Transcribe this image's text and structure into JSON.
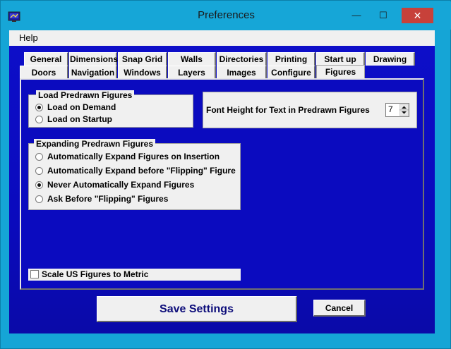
{
  "window": {
    "title": "Preferences",
    "minimize_glyph": "—",
    "maximize_glyph": "☐",
    "close_glyph": "✕"
  },
  "menu": {
    "help": "Help"
  },
  "tabs": {
    "row1": [
      "General",
      "Dimensions",
      "Snap Grid",
      "Walls",
      "Directories",
      "Printing",
      "Start up",
      "Drawing"
    ],
    "row2": [
      "Doors",
      "Navigation",
      "Windows",
      "Layers",
      "Images",
      "Configure",
      "Figures"
    ],
    "active": "Figures"
  },
  "load_group": {
    "title": "Load Predrawn Figures",
    "options": [
      "Load on Demand",
      "Load on Startup"
    ],
    "selected": 0
  },
  "font_height": {
    "label": "Font Height for Text in Predrawn Figures",
    "value": "7"
  },
  "expand_group": {
    "title": "Expanding Predrawn Figures",
    "options": [
      "Automatically Expand Figures on Insertion",
      "Automatically Expand before \"Flipping\" Figure",
      "Never Automatically Expand Figures",
      "Ask Before \"Flipping\" Figures"
    ],
    "selected": 2
  },
  "scale_checkbox": {
    "label": "Scale US Figures to Metric",
    "checked": false
  },
  "buttons": {
    "save": "Save Settings",
    "cancel": "Cancel"
  },
  "colors": {
    "frame": "#15a5d6",
    "panel_blue": "#0b0bbf",
    "close_red": "#c7413a"
  },
  "icons": {
    "app": "app-icon",
    "stepper": "spin-arrows-icon"
  }
}
